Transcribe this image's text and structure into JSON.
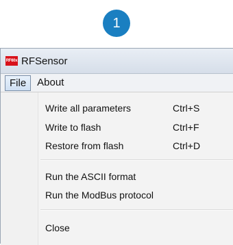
{
  "step_badge": "1",
  "window": {
    "icon_text": "RF60x",
    "title": "RFSensor"
  },
  "menubar": {
    "file_label": "File",
    "about_label": "About"
  },
  "file_menu": {
    "write_all": {
      "label": "Write all parameters",
      "shortcut": "Ctrl+S"
    },
    "write_flash": {
      "label": "Write to flash",
      "shortcut": "Ctrl+F"
    },
    "restore_flash": {
      "label": "Restore from flash",
      "shortcut": "Ctrl+D"
    },
    "run_ascii": {
      "label": "Run the ASCII format"
    },
    "run_modbus": {
      "label": "Run the ModBus protocol"
    },
    "close": {
      "label": "Close"
    }
  }
}
